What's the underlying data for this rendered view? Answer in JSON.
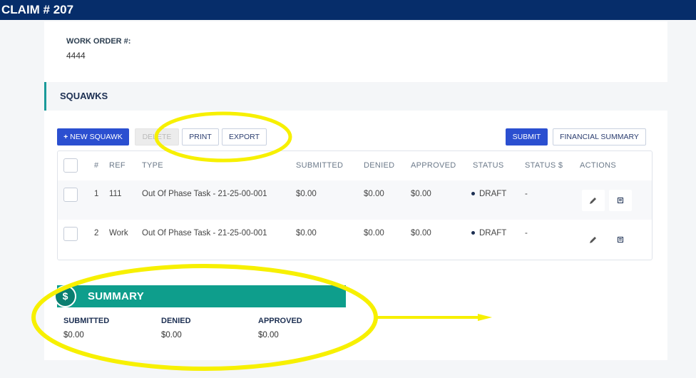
{
  "header": {
    "title": "CLAIM # 207"
  },
  "work_order": {
    "label": "WORK ORDER #:",
    "value": "4444"
  },
  "squawks": {
    "title": "SQUAWKS"
  },
  "toolbar": {
    "new_label": "NEW SQUAWK",
    "delete_label": "DELETE",
    "print_label": "PRINT",
    "export_label": "EXPORT",
    "submit_label": "SUBMIT",
    "financial_label": "FINANCIAL SUMMARY"
  },
  "table": {
    "columns": [
      "#",
      "REF",
      "TYPE",
      "SUBMITTED",
      "DENIED",
      "APPROVED",
      "STATUS",
      "STATUS $",
      "ACTIONS"
    ],
    "rows": [
      {
        "num": "1",
        "ref": "111",
        "type": "Out Of Phase Task - 21-25-00-001",
        "submitted": "$0.00",
        "denied": "$0.00",
        "approved": "$0.00",
        "status": "DRAFT",
        "status_amount": "-"
      },
      {
        "num": "2",
        "ref": "Work",
        "type": "Out Of Phase Task - 21-25-00-001",
        "submitted": "$0.00",
        "denied": "$0.00",
        "approved": "$0.00",
        "status": "DRAFT",
        "status_amount": "-"
      }
    ]
  },
  "summary": {
    "title": "SUMMARY",
    "icon_glyph": "$",
    "submitted_label": "SUBMITTED",
    "submitted_value": "$0.00",
    "denied_label": "DENIED",
    "denied_value": "$0.00",
    "approved_label": "APPROVED",
    "approved_value": "$0.00"
  },
  "colors": {
    "header_bg": "#062d6a",
    "primary": "#2b4fd0",
    "summary_teal": "#0e9e8c",
    "annotation": "#f7f000"
  }
}
